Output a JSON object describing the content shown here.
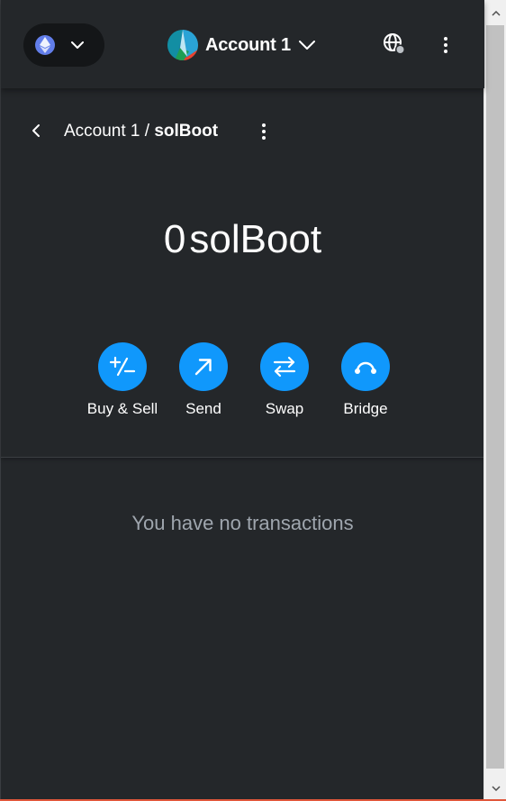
{
  "header": {
    "network": {
      "icon": "ethereum-icon",
      "chevron_icon": "chevron-down-icon"
    },
    "account": {
      "name": "Account 1",
      "avatar_icon": "account-avatar-icon",
      "chevron_icon": "chevron-down-icon"
    },
    "connection_icon": "globe-connection-icon",
    "menu_icon": "kebab-menu-icon"
  },
  "token_view": {
    "back_icon": "chevron-left-icon",
    "breadcrumb": {
      "account": "Account 1",
      "separator": " / ",
      "token": "solBoot"
    },
    "menu_icon": "kebab-menu-icon",
    "balance": {
      "amount": "0",
      "symbol": "solBoot"
    },
    "actions": [
      {
        "label": "Buy & Sell",
        "icon": "plus-minus-icon"
      },
      {
        "label": "Send",
        "icon": "arrow-up-right-icon"
      },
      {
        "label": "Swap",
        "icon": "swap-arrows-icon"
      },
      {
        "label": "Bridge",
        "icon": "bridge-icon"
      }
    ]
  },
  "activity": {
    "empty_message": "You have no transactions"
  },
  "colors": {
    "background": "#24272a",
    "accent": "#1098fc",
    "muted_text": "#9fa6ae",
    "ethereum": "#627eea"
  }
}
